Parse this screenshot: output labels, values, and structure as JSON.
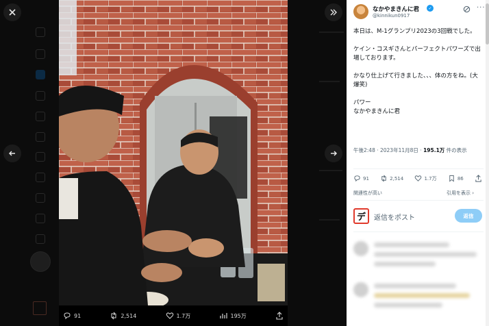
{
  "post": {
    "display_name": "なかやまきんに君",
    "handle": "@kinnikun0917",
    "body_paragraphs": [
      "本日は、M-1グランプリ2023の3回戦でした。",
      "ケイン・コスギさんとパーフェクトパワーズで出場しております。",
      "かなり仕上げて行きました、、、体の方をね。(大爆笑)",
      "パワー\nなかやまきんに君"
    ],
    "timestamp": "午後2:48 · 2023年11月8日 · ",
    "views_count": "195.1万",
    "views_suffix": " 件の表示"
  },
  "sidebar_actions": {
    "replies": "91",
    "reposts": "2,514",
    "likes": "1.7万",
    "bookmarks": "86"
  },
  "related_label": "関連性が高い",
  "show_label": "引用を表示 ›",
  "reply_box": {
    "placeholder": "返信をポスト",
    "button_label": "返信",
    "logo_char": "デ"
  },
  "media_actions": {
    "replies": "91",
    "reposts": "2,514",
    "likes": "1.7万",
    "views": "195万"
  },
  "icons": {
    "close": "close-icon",
    "collapse": "double-chevron-right-icon",
    "prev": "arrow-left-icon",
    "next": "arrow-right-icon",
    "more": "more-icon",
    "grok": "grok-icon"
  },
  "colors": {
    "accent": "#1d9bf0",
    "reply_button": "#8ecdf7"
  }
}
